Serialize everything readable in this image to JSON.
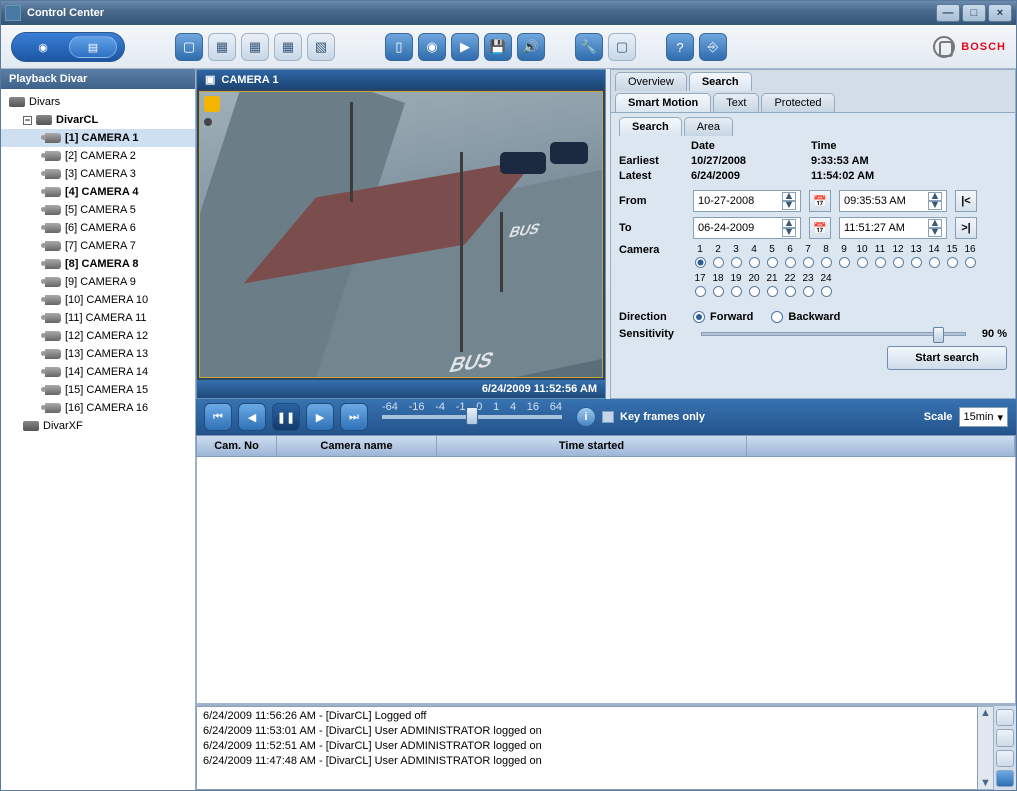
{
  "title": "Control Center",
  "brand": "BOSCH",
  "sidebar": {
    "header": "Playback Divar",
    "root": "Divars",
    "devices": [
      {
        "name": "DivarCL",
        "expanded": true,
        "cameras": [
          {
            "label": "[1] CAMERA 1",
            "bold": true,
            "selected": true
          },
          {
            "label": "[2] CAMERA 2"
          },
          {
            "label": "[3] CAMERA 3"
          },
          {
            "label": "[4] CAMERA 4",
            "bold": true
          },
          {
            "label": "[5] CAMERA 5"
          },
          {
            "label": "[6] CAMERA 6"
          },
          {
            "label": "[7] CAMERA 7"
          },
          {
            "label": "[8] CAMERA 8",
            "bold": true
          },
          {
            "label": "[9] CAMERA 9"
          },
          {
            "label": "[10] CAMERA 10"
          },
          {
            "label": "[11] CAMERA 11"
          },
          {
            "label": "[12] CAMERA 12"
          },
          {
            "label": "[13] CAMERA 13"
          },
          {
            "label": "[14] CAMERA 14"
          },
          {
            "label": "[15] CAMERA 15"
          },
          {
            "label": "[16] CAMERA 16"
          }
        ]
      },
      {
        "name": "DivarXF",
        "expanded": false
      }
    ]
  },
  "video": {
    "title": "CAMERA 1",
    "timestamp": "6/24/2009 11:52:56 AM"
  },
  "tabs": {
    "row1": [
      "Overview",
      "Search"
    ],
    "row1_active": 1,
    "row2": [
      "Smart Motion",
      "Text",
      "Protected"
    ],
    "row2_active": 0,
    "sub": [
      "Search",
      "Area"
    ],
    "sub_active": 0
  },
  "search": {
    "headers": {
      "date": "Date",
      "time": "Time"
    },
    "earliest": {
      "lbl": "Earliest",
      "date": "10/27/2008",
      "time": "9:33:53 AM"
    },
    "latest": {
      "lbl": "Latest",
      "date": "6/24/2009",
      "time": "11:54:02 AM"
    },
    "from": {
      "lbl": "From",
      "date": "10-27-2008",
      "time": "09:35:53 AM"
    },
    "to": {
      "lbl": "To",
      "date": "06-24-2009",
      "time": "11:51:27 AM"
    },
    "camera_lbl": "Camera",
    "camera_rows": [
      [
        1,
        2,
        3,
        4,
        5,
        6,
        7,
        8,
        9,
        10,
        11,
        12,
        13,
        14,
        15,
        16
      ],
      [
        17,
        18,
        19,
        20,
        21,
        22,
        23,
        24
      ]
    ],
    "camera_selected": 1,
    "direction_lbl": "Direction",
    "dir_forward": "Forward",
    "dir_backward": "Backward",
    "direction_value": "Forward",
    "sensitivity_lbl": "Sensitivity",
    "sensitivity_value": "90 %",
    "start_btn": "Start search"
  },
  "playback": {
    "speed_ticks": [
      "-64",
      "-16",
      "-4",
      "-1",
      "0",
      "1",
      "4",
      "16",
      "64"
    ],
    "keyframes_lbl": "Key frames only",
    "scale_lbl": "Scale",
    "scale_value": "15min"
  },
  "table": {
    "columns": [
      "Cam. No",
      "Camera name",
      "Time started",
      ""
    ]
  },
  "log": {
    "lines": [
      "6/24/2009 11:56:26 AM - [DivarCL] Logged off",
      "6/24/2009 11:53:01 AM - [DivarCL] User ADMINISTRATOR logged on",
      "6/24/2009 11:52:51 AM - [DivarCL] User ADMINISTRATOR logged on",
      "6/24/2009 11:47:48 AM - [DivarCL] User ADMINISTRATOR logged on"
    ]
  }
}
